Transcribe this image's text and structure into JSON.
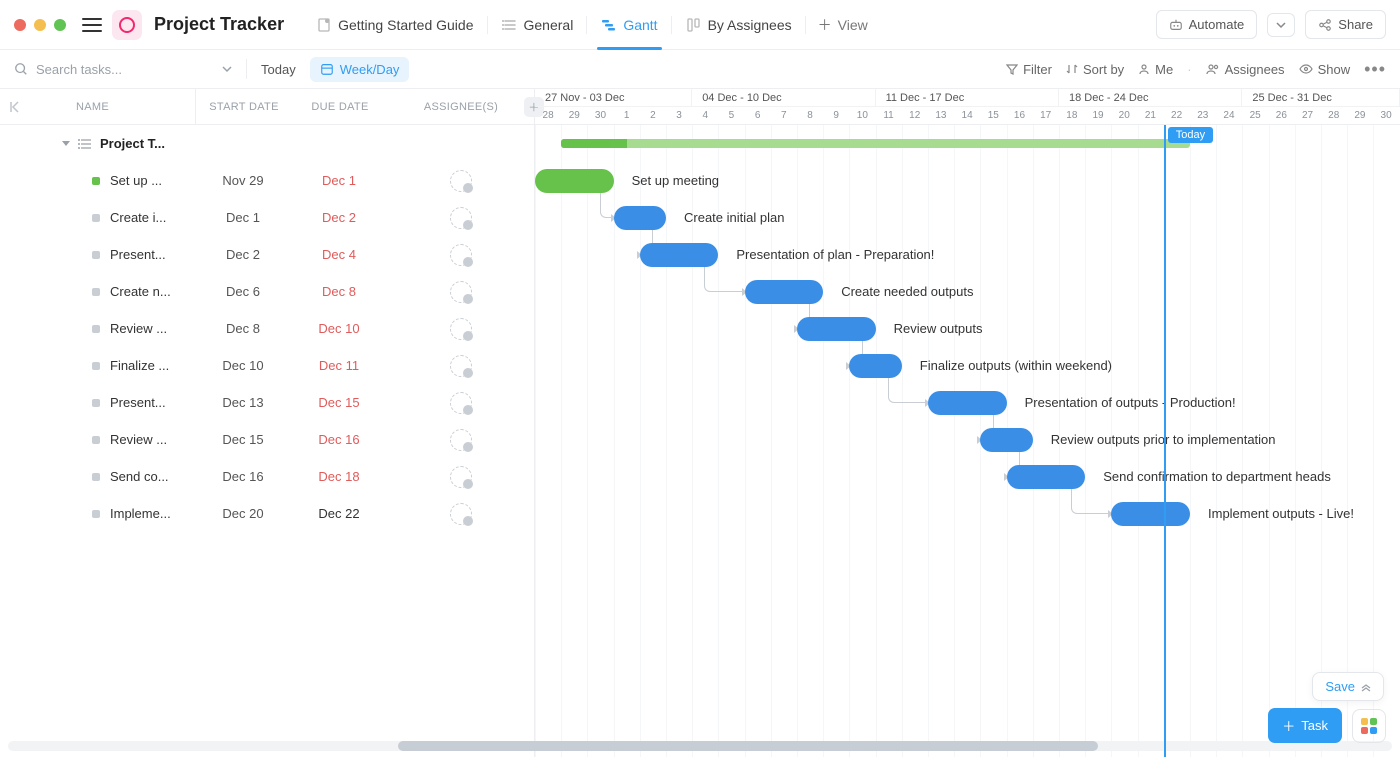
{
  "header": {
    "title": "Project Tracker",
    "tabs": [
      {
        "label": "Getting Started Guide",
        "icon": "doc-pin-icon"
      },
      {
        "label": "General",
        "icon": "list-icon"
      },
      {
        "label": "Gantt",
        "icon": "gantt-icon",
        "active": true
      },
      {
        "label": "By Assignees",
        "icon": "board-icon"
      }
    ],
    "view_btn": "View",
    "automate_btn": "Automate",
    "share_btn": "Share"
  },
  "toolbar": {
    "search_placeholder": "Search tasks...",
    "today": "Today",
    "timescale": "Week/Day",
    "filter": "Filter",
    "sortby": "Sort by",
    "me": "Me",
    "assignees": "Assignees",
    "show": "Show"
  },
  "columns": {
    "name": "NAME",
    "start": "Start Date",
    "due": "Due Date",
    "assignee": "Assignee(s)"
  },
  "group_name": "Project T...",
  "tasks": [
    {
      "name": "Set up ...",
      "full": "Set up meeting",
      "start": "Nov 29",
      "due": "Dec 1",
      "due_red": true,
      "bar_start_day": 0,
      "bar_end_day": 3,
      "green": true
    },
    {
      "name": "Create i...",
      "full": "Create initial plan",
      "start": "Dec 1",
      "due": "Dec 2",
      "due_red": true,
      "bar_start_day": 3,
      "bar_end_day": 5
    },
    {
      "name": "Present...",
      "full": "Presentation of plan - Preparation!",
      "start": "Dec 2",
      "due": "Dec 4",
      "due_red": true,
      "bar_start_day": 4,
      "bar_end_day": 7
    },
    {
      "name": "Create n...",
      "full": "Create needed outputs",
      "start": "Dec 6",
      "due": "Dec 8",
      "due_red": true,
      "bar_start_day": 8,
      "bar_end_day": 11
    },
    {
      "name": "Review ...",
      "full": "Review outputs",
      "start": "Dec 8",
      "due": "Dec 10",
      "due_red": true,
      "bar_start_day": 10,
      "bar_end_day": 13
    },
    {
      "name": "Finalize ...",
      "full": "Finalize outputs (within weekend)",
      "start": "Dec 10",
      "due": "Dec 11",
      "due_red": true,
      "bar_start_day": 12,
      "bar_end_day": 14
    },
    {
      "name": "Present...",
      "full": "Presentation of outputs - Production!",
      "start": "Dec 13",
      "due": "Dec 15",
      "due_red": true,
      "bar_start_day": 15,
      "bar_end_day": 18
    },
    {
      "name": "Review ...",
      "full": "Review outputs prior to implementation",
      "start": "Dec 15",
      "due": "Dec 16",
      "due_red": true,
      "bar_start_day": 17,
      "bar_end_day": 19
    },
    {
      "name": "Send co...",
      "full": "Send confirmation to department heads",
      "start": "Dec 16",
      "due": "Dec 18",
      "due_red": true,
      "bar_start_day": 18,
      "bar_end_day": 21
    },
    {
      "name": "Impleme...",
      "full": "Implement outputs - Live!",
      "start": "Dec 20",
      "due": "Dec 22",
      "due_red": false,
      "bar_start_day": 22,
      "bar_end_day": 25
    }
  ],
  "timeline": {
    "weeks": [
      {
        "label": "27 Nov - 03 Dec",
        "days": 6
      },
      {
        "label": "04 Dec - 10 Dec",
        "days": 7
      },
      {
        "label": "11 Dec - 17 Dec",
        "days": 7
      },
      {
        "label": "18 Dec - 24 Dec",
        "days": 7
      },
      {
        "label": "25 Dec - 31 Dec",
        "days": 6
      }
    ],
    "days": [
      "28",
      "29",
      "30",
      "1",
      "2",
      "3",
      "4",
      "5",
      "6",
      "7",
      "8",
      "9",
      "10",
      "11",
      "12",
      "13",
      "14",
      "15",
      "16",
      "17",
      "18",
      "19",
      "20",
      "21",
      "22",
      "23",
      "24",
      "25",
      "26",
      "27",
      "28",
      "29",
      "30"
    ],
    "day_width": 26.2,
    "today_index": 24,
    "today_label": "Today",
    "summary_start": 1,
    "summary_end": 25,
    "summary_progress_end": 3.5
  },
  "footer": {
    "save": "Save",
    "task_btn": "Task"
  },
  "colors": {
    "accent": "#2f9df4",
    "green": "#66c24a",
    "red": "#e05b5b"
  }
}
